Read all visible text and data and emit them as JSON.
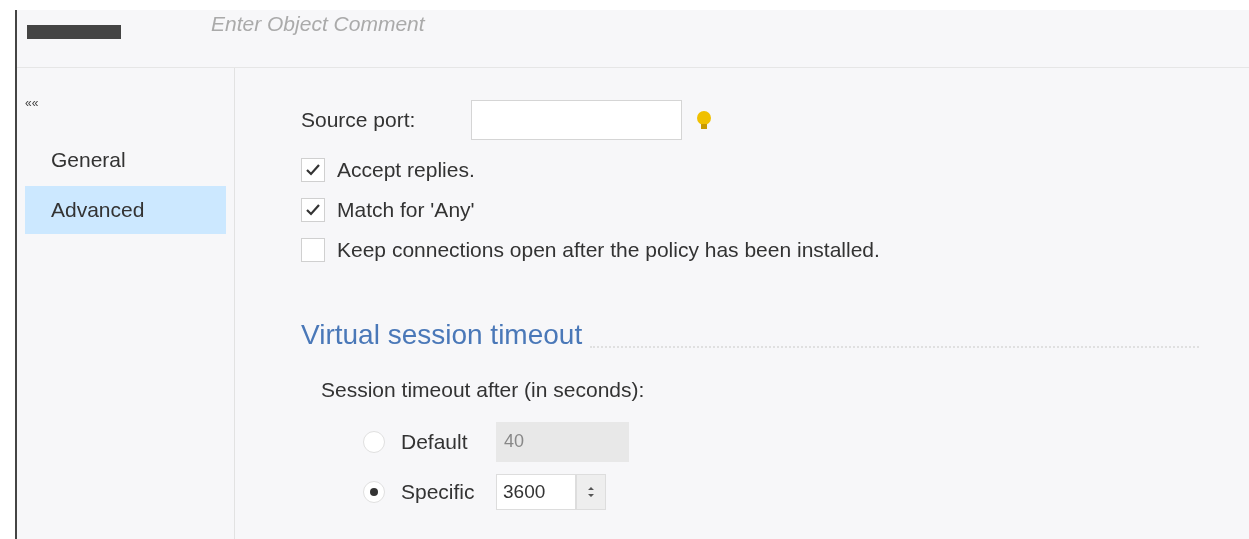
{
  "header": {
    "comment_placeholder": "Enter Object Comment"
  },
  "sidebar": {
    "collapse": "««",
    "items": [
      {
        "label": "General",
        "selected": false
      },
      {
        "label": "Advanced",
        "selected": true
      }
    ]
  },
  "source_port": {
    "label": "Source port:"
  },
  "options": [
    {
      "label": "Accept replies.",
      "checked": true
    },
    {
      "label": "Match for 'Any'",
      "checked": true
    },
    {
      "label": "Keep connections open after the policy has been installed.",
      "checked": false
    }
  ],
  "section": {
    "title": "Virtual session timeout",
    "label": "Session timeout after (in seconds):",
    "choices": [
      {
        "label": "Default",
        "value": "40",
        "selected": false,
        "kind": "field"
      },
      {
        "label": "Specific",
        "value": "3600",
        "selected": true,
        "kind": "spinner"
      }
    ]
  }
}
